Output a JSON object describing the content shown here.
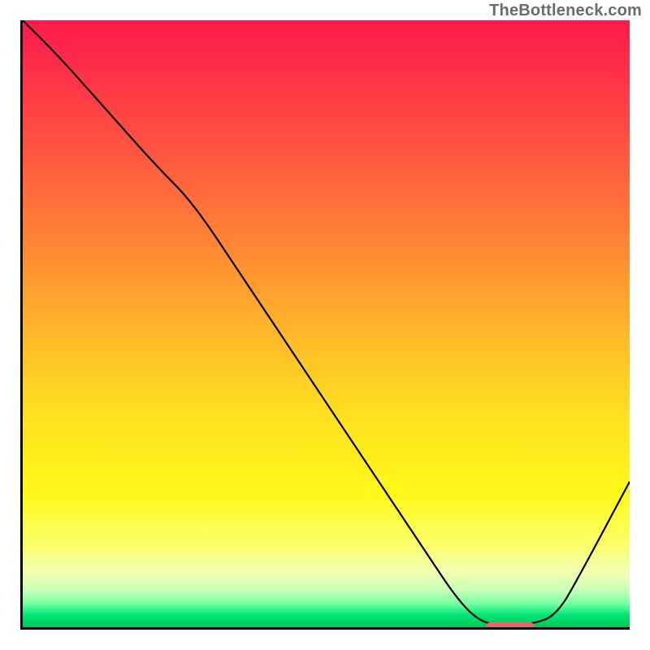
{
  "watermark": {
    "text": "TheBottleneck.com"
  },
  "chart_data": {
    "type": "line",
    "title": "",
    "xlabel": "",
    "ylabel": "",
    "xlim": [
      0,
      100
    ],
    "ylim": [
      0,
      100
    ],
    "grid": false,
    "legend": false,
    "background_gradient": {
      "direction": "vertical",
      "stops": [
        {
          "pos": 0,
          "color": "#ff1a4d"
        },
        {
          "pos": 22,
          "color": "#ff5740"
        },
        {
          "pos": 52,
          "color": "#ffb929"
        },
        {
          "pos": 78,
          "color": "#fff81a"
        },
        {
          "pos": 94,
          "color": "#c7ffb7"
        },
        {
          "pos": 100,
          "color": "#00c853"
        }
      ]
    },
    "series": [
      {
        "name": "bottleneck-curve",
        "x": [
          0,
          6,
          14,
          22,
          28,
          36,
          46,
          56,
          66,
          72,
          76,
          80,
          84,
          88,
          92,
          100
        ],
        "y": [
          100,
          94,
          85,
          76,
          70,
          58,
          43,
          28,
          13,
          4,
          0.5,
          0.5,
          0.5,
          2,
          9,
          24
        ]
      }
    ],
    "marker": {
      "name": "optimal-range",
      "x_start": 76,
      "x_end": 84,
      "y": 0.5,
      "color": "#e46a6a"
    }
  }
}
